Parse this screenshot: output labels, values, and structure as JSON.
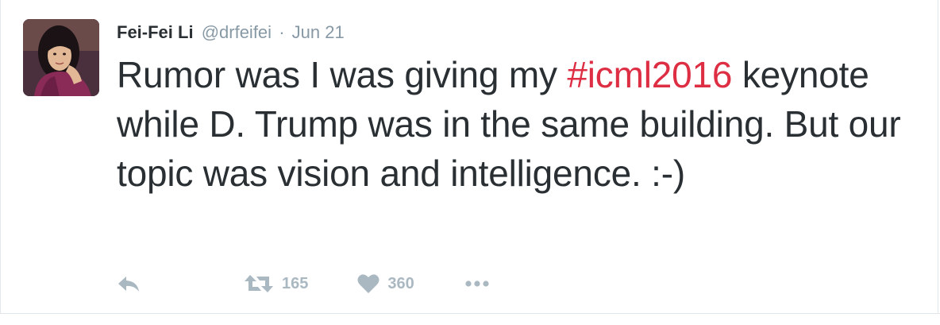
{
  "tweet": {
    "author": {
      "fullname": "Fei-Fei Li",
      "username": "@drfeifei",
      "separator": "·",
      "timestamp": "Jun 21"
    },
    "text_parts": {
      "before_hashtag": "Rumor was I was giving my ",
      "hashtag": "#icml2016",
      "after_hashtag": " keynote while D. Trump was in the same building. But our topic was vision and intelligence. :-)"
    },
    "actions": {
      "reply_icon": "reply-icon",
      "retweet_icon": "retweet-icon",
      "retweet_count": "165",
      "like_icon": "heart-icon",
      "like_count": "360",
      "more_icon": "more-dots-icon"
    },
    "colors": {
      "text": "#292f33",
      "muted": "#8899a6",
      "icon": "#aab8c2",
      "hashtag": "#dd2e44",
      "border": "#e1e8ed"
    }
  }
}
